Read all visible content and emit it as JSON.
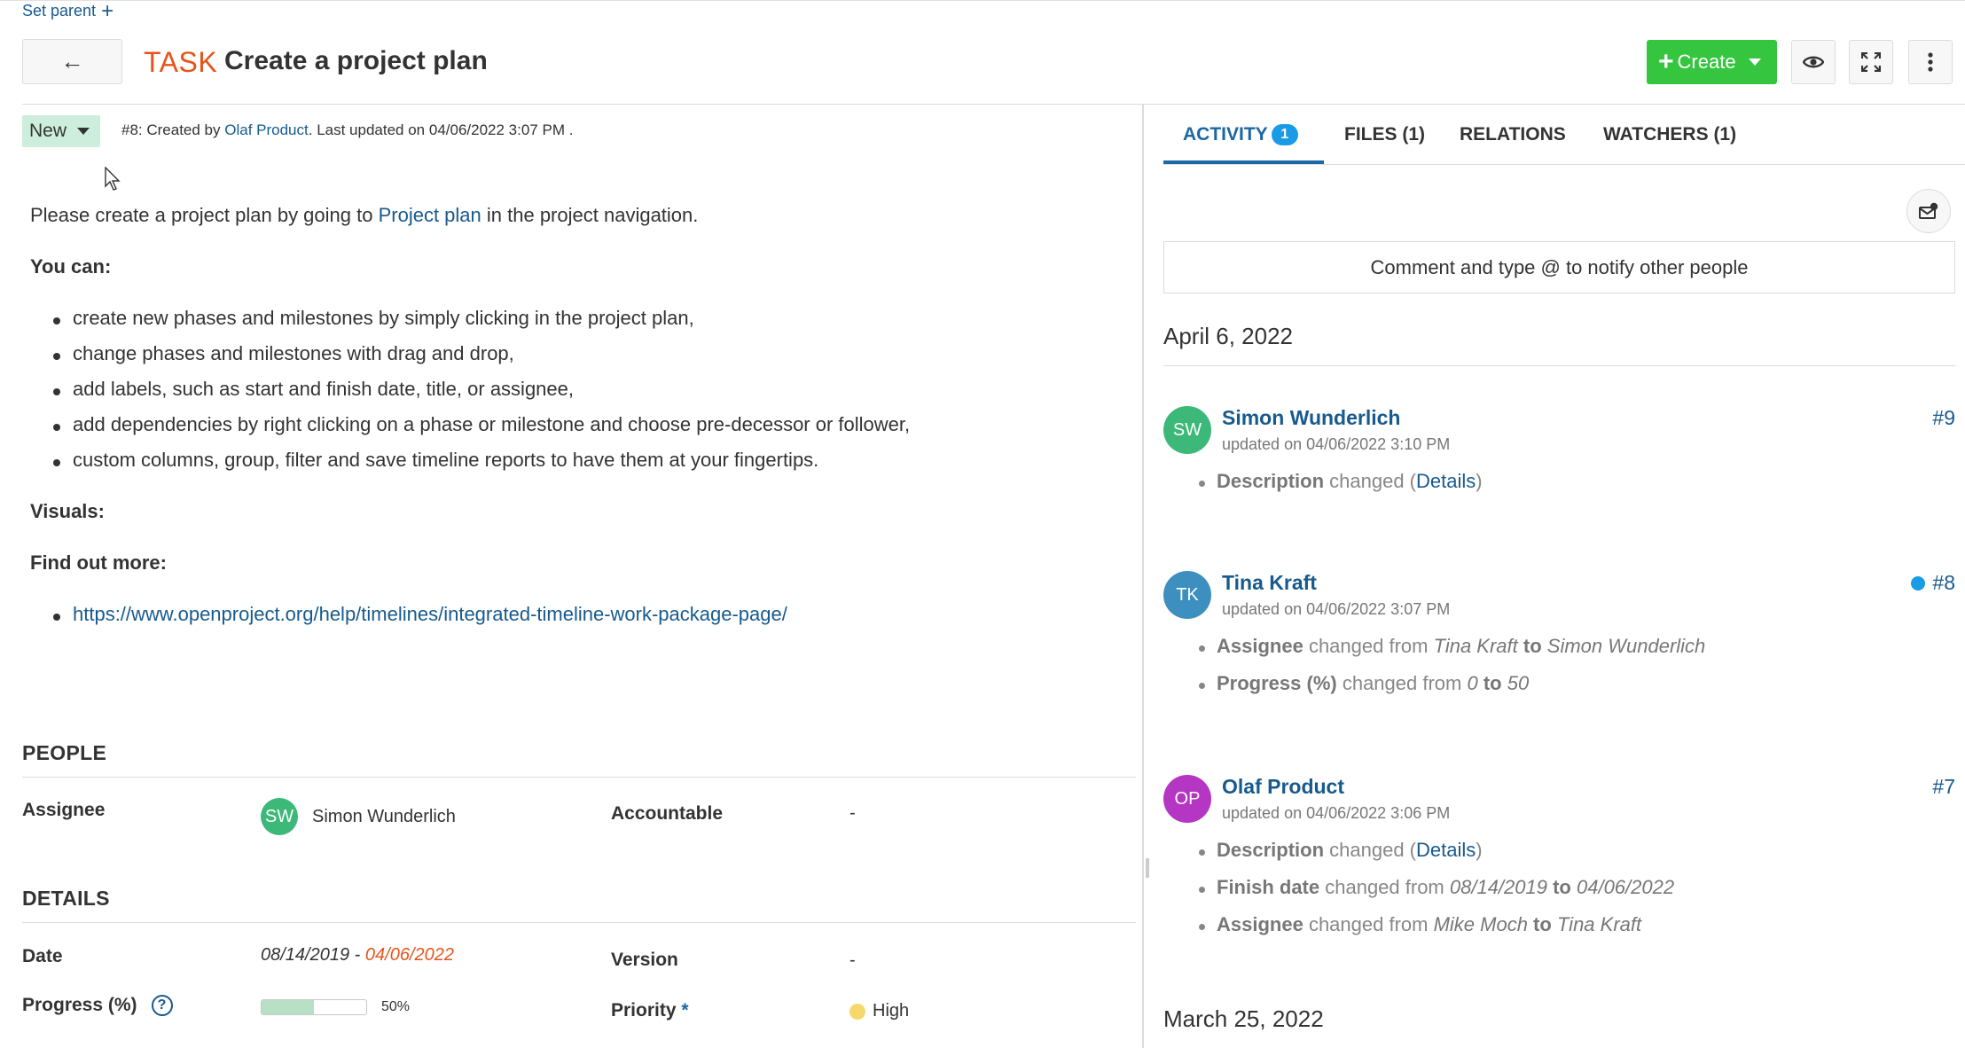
{
  "header": {
    "set_parent": "Set parent",
    "back_glyph": "←",
    "type": "TASK",
    "subject": "Create a project plan",
    "create_label": "Create"
  },
  "status": {
    "label": "New"
  },
  "meta": {
    "prefix": "#8: Created by ",
    "author": "Olaf Product",
    "suffix": ". Last updated on 04/06/2022 3:07 PM ."
  },
  "description": {
    "intro_before": "Please create a project plan by going to ",
    "intro_link": "Project plan",
    "intro_after": " in the project navigation.",
    "you_can": "You can:",
    "bullets": [
      "create new phases and milestones by simply clicking in the project plan,",
      "change phases and milestones with drag and drop,",
      "add labels, such as start and finish date, title, or assignee,",
      "add dependencies by right clicking on a phase or milestone and choose pre-decessor or follower,",
      "custom columns, group, filter and save timeline reports to have them at your fingertips."
    ],
    "visuals": "Visuals:",
    "find_out_more": "Find out more:",
    "link": "https://www.openproject.org/help/timelines/integrated-timeline-work-package-page/"
  },
  "people": {
    "title": "PEOPLE",
    "assignee_label": "Assignee",
    "assignee_initials": "SW",
    "assignee_name": "Simon Wunderlich",
    "accountable_label": "Accountable",
    "accountable_value": "-"
  },
  "details": {
    "title": "DETAILS",
    "date_label": "Date",
    "start_date": "08/14/2019",
    "date_sep": " - ",
    "finish_date": "04/06/2022",
    "version_label": "Version",
    "version_value": "-",
    "progress_label": "Progress (%)",
    "progress_value": "50%",
    "progress_fraction": 0.5,
    "priority_label": "Priority",
    "priority_required": "*",
    "priority_value": "High"
  },
  "tabs": {
    "activity": "ACTIVITY",
    "activity_badge": "1",
    "files": "FILES (1)",
    "relations": "RELATIONS",
    "watchers": "WATCHERS (1)"
  },
  "comment_placeholder": "Comment and type @ to notify other people",
  "activity": {
    "date1": "April 6, 2022",
    "date2": "March 25, 2022",
    "journals": [
      {
        "initials": "SW",
        "color": "#3cb878",
        "user": "Simon Wunderlich",
        "time": "updated on 04/06/2022 3:10 PM",
        "number": "#9",
        "d1_attr": "Description",
        "d1_text": " changed (",
        "d1_link": "Details",
        "d1_end": ")"
      },
      {
        "initials": "TK",
        "color": "#3d8fbf",
        "user": "Tina Kraft",
        "time": "updated on 04/06/2022 3:07 PM",
        "number": "#8",
        "d1_attr": "Assignee",
        "d1_text": " changed from ",
        "d1_from": "Tina Kraft",
        "d1_to": " to ",
        "d1_new": "Simon Wunderlich",
        "d2_attr": "Progress (%)",
        "d2_text": " changed from ",
        "d2_from": "0",
        "d2_to": " to ",
        "d2_new": "50"
      },
      {
        "initials": "OP",
        "color": "#b536c2",
        "user": "Olaf Product",
        "time": "updated on 04/06/2022 3:06 PM",
        "number": "#7",
        "d1_attr": "Description",
        "d1_text": " changed (",
        "d1_link": "Details",
        "d1_end": ")",
        "d2_attr": "Finish date",
        "d2_text": " changed from ",
        "d2_from": "08/14/2019",
        "d2_to": " to ",
        "d2_new": "04/06/2022",
        "d3_attr": "Assignee",
        "d3_text": " changed from ",
        "d3_from": "Mike Moch",
        "d3_to": " to ",
        "d3_new": "Tina Kraft"
      }
    ]
  },
  "colors": {
    "type_accent": "#e5541b",
    "create_green": "#35c53f",
    "link_blue": "#175a8e",
    "status_bg": "#cdeedd",
    "priority_high": "#f6d96b"
  },
  "icons": {
    "back": "arrow-left-icon",
    "watch": "eye-icon",
    "fullscreen": "expand-icon",
    "more": "more-vertical-icon",
    "help": "help-icon",
    "mail": "mail-notification-icon"
  }
}
